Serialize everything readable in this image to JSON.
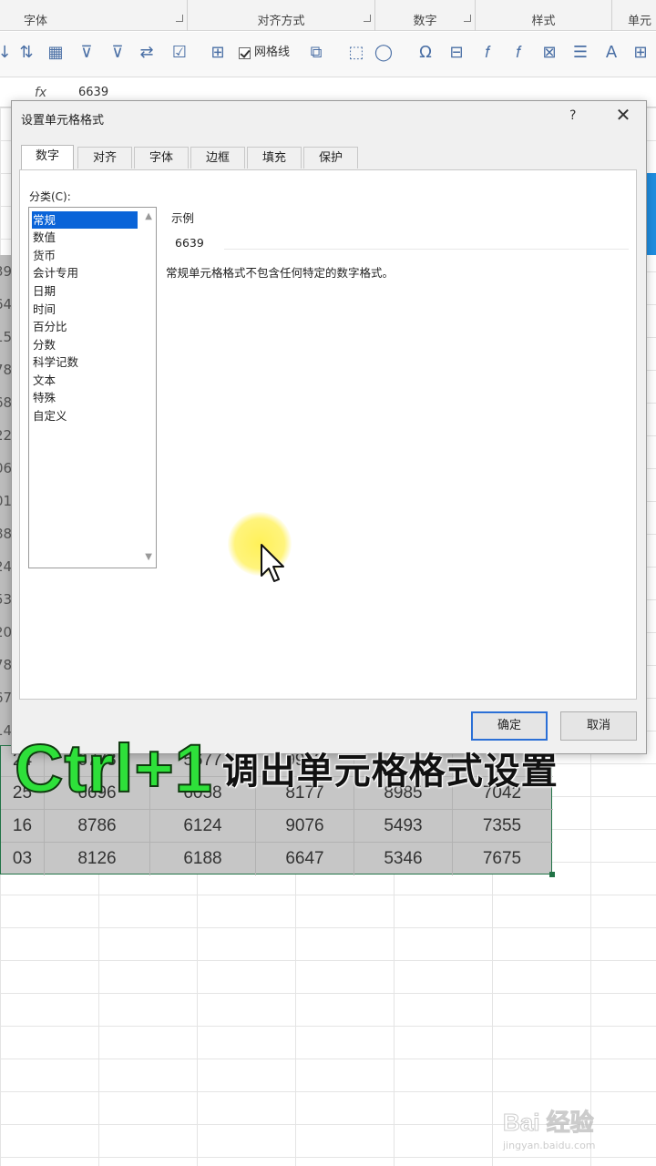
{
  "ribbon": {
    "groups": [
      "字体",
      "对齐方式",
      "数字",
      "样式",
      "单元"
    ],
    "gridlines_label": "网格线"
  },
  "formula_bar": {
    "fx_label": "fx",
    "value": "6639"
  },
  "sheet": {
    "left_col_fragments": [
      "39",
      "64",
      "15",
      "78",
      "68",
      "22",
      "06",
      "01",
      "88",
      "24",
      "53",
      "20",
      "78",
      "67",
      "14",
      "24",
      "25",
      "16",
      "03"
    ],
    "rows": [
      [
        "24",
        "6778",
        "5677",
        "9912",
        "",
        ""
      ],
      [
        "25",
        "6696",
        "6058",
        "8177",
        "8985",
        "7042"
      ],
      [
        "16",
        "8786",
        "6124",
        "9076",
        "5493",
        "7355"
      ],
      [
        "03",
        "8126",
        "6188",
        "6647",
        "5346",
        "7675"
      ]
    ]
  },
  "dialog": {
    "title": "设置单元格格式",
    "help": "?",
    "tabs": [
      "数字",
      "对齐",
      "字体",
      "边框",
      "填充",
      "保护"
    ],
    "active_tab": "数字",
    "category_label": "分类(C):",
    "categories": [
      "常规",
      "数值",
      "货币",
      "会计专用",
      "日期",
      "时间",
      "百分比",
      "分数",
      "科学记数",
      "文本",
      "特殊",
      "自定义"
    ],
    "selected_category": "常规",
    "sample_label": "示例",
    "sample_value": "6639",
    "description": "常规单元格格式不包含任何特定的数字格式。",
    "ok_label": "确定",
    "cancel_label": "取消"
  },
  "caption": {
    "key": "Ctrl+1",
    "text": "调出单元格格式设置"
  },
  "watermark": {
    "logo": "Bai 经验",
    "url": "jingyan.baidu.com"
  },
  "colors": {
    "caption_key": "#2ee03a",
    "selection": "#0a64d8",
    "ok_border": "#2a6fd6",
    "sheet_selection_border": "#217346"
  }
}
